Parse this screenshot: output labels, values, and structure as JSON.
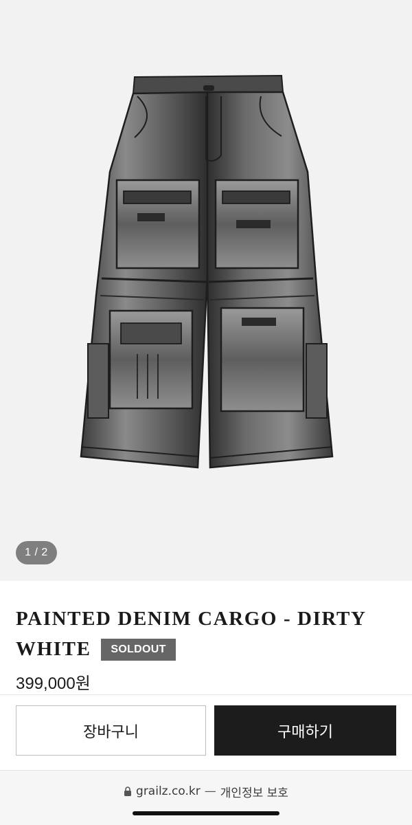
{
  "gallery": {
    "counter": "1 / 2",
    "background": "#f2f2f2"
  },
  "product": {
    "title": "PAINTED DENIM CARGO - DIRTY WHITE",
    "badge": "SOLDOUT",
    "price": "399,000원"
  },
  "actions": {
    "cart_label": "장바구니",
    "buy_label": "구매하기",
    "buy_color": "#1c1c1c"
  },
  "browser": {
    "url": "grailz.co.kr",
    "separator": "—",
    "privacy": "개인정보 보호"
  }
}
